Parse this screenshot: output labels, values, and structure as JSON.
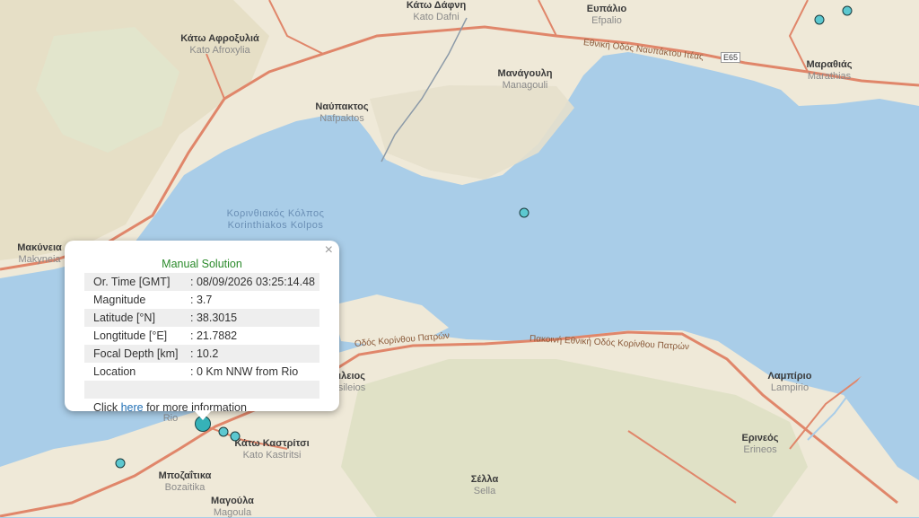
{
  "map": {
    "water_color": "#a9cde8",
    "land_color": "#efe9d8",
    "road_color": "#e0866a",
    "places": [
      {
        "id": "kato-dafni",
        "gr": "Κάτω Δάφνη",
        "lt": "Kato Dafni"
      },
      {
        "id": "efpalio",
        "gr": "Ευπάλιο",
        "lt": "Efpalio"
      },
      {
        "id": "kato-afroxylia",
        "gr": "Κάτω Αφροξυλιά",
        "lt": "Kato Afroxylia"
      },
      {
        "id": "managouli",
        "gr": "Μανάγουλη",
        "lt": "Managouli"
      },
      {
        "id": "marathias",
        "gr": "Μαραθιάς",
        "lt": "Marathias"
      },
      {
        "id": "nafpaktos",
        "gr": "Ναύπακτος",
        "lt": "Nafpaktos"
      },
      {
        "id": "korinthiakos",
        "gr": "Κορινθιακός Κόλπος",
        "lt": "Korinthiakos Kolpos"
      },
      {
        "id": "makyneia",
        "gr": "Μακύνεια",
        "lt": "Makyneia"
      },
      {
        "id": "lampirio",
        "gr": "Λαμπίριο",
        "lt": "Lampirio"
      },
      {
        "id": "erineos",
        "gr": "Ερινεός",
        "lt": "Erineos"
      },
      {
        "id": "kato-kastritsi",
        "gr": "Κάτω Καστρίτσι",
        "lt": "Kato Kastritsi"
      },
      {
        "id": "bozaitika",
        "gr": "Μποζαΐτικα",
        "lt": "Bozaitika"
      },
      {
        "id": "sella",
        "gr": "Σέλλα",
        "lt": "Sella"
      },
      {
        "id": "magoula",
        "gr": "Μαγούλα",
        "lt": "Magoula"
      },
      {
        "id": "rio-partial",
        "gr": "",
        "lt": "Rio"
      },
      {
        "id": "vasileios-partial",
        "gr": "ιλειος",
        "lt": "sileios"
      }
    ],
    "road_labels": [
      {
        "id": "ethniki-nafpaktou",
        "text": "Εθνική Οδός Ναυπάκτου Ιτέας"
      },
      {
        "id": "e65",
        "text": "E65"
      },
      {
        "id": "ethniki-korinthou-patron",
        "text": "Πακοινή Εθνική Οδός Κορίνθου Πατρών"
      },
      {
        "id": "odos-korinthou-patron",
        "text": "Οδός Κορίνθου Πατρών"
      }
    ],
    "quakes": [
      {
        "id": "q1"
      },
      {
        "id": "q2"
      },
      {
        "id": "q3"
      },
      {
        "id": "q4"
      },
      {
        "id": "q5"
      },
      {
        "id": "q6",
        "selected": true
      },
      {
        "id": "q7"
      }
    ]
  },
  "popup": {
    "title": "Manual Solution",
    "rows": [
      {
        "key": "Or. Time [GMT]",
        "value": ": 08/09/2026 03:25:14.48"
      },
      {
        "key": "Magnitude",
        "value": ": 3.7"
      },
      {
        "key": "Latitude [°N]",
        "value": ": 38.3015"
      },
      {
        "key": "Longtitude [°E]",
        "value": ": 21.7882"
      },
      {
        "key": "Focal Depth [km]",
        "value": ": 10.2"
      },
      {
        "key": "Location",
        "value": ": 0 Km NNW from Rio"
      }
    ],
    "footer_prefix": "Click ",
    "footer_link": "here",
    "footer_suffix": " for more information",
    "close_symbol": "×"
  }
}
